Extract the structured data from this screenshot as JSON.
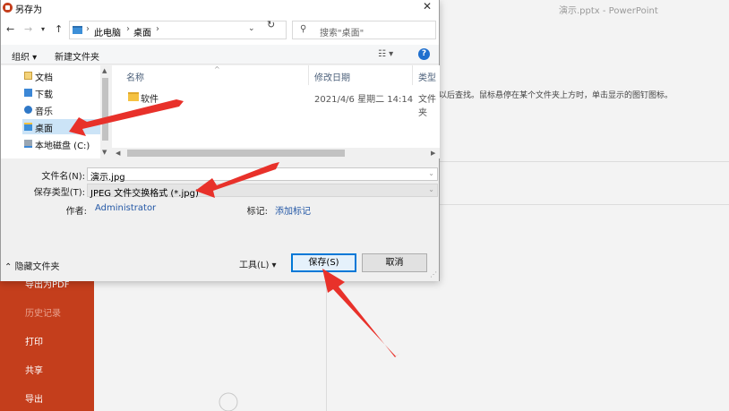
{
  "background": {
    "window_title": "演示.pptx  -  PowerPoint",
    "hint_text": "以后查找。鼠标悬停在某个文件夹上方时，单击显示的图钉图标。",
    "nav": {
      "export_pdf": "导出为PDF",
      "history": "历史记录",
      "print": "打印",
      "share": "共享",
      "export": "导出"
    },
    "accent_color": "#c43e1c"
  },
  "dialog": {
    "title": "另存为",
    "breadcrumb": [
      "此电脑",
      "桌面"
    ],
    "search_placeholder": "搜索\"桌面\"",
    "toolbar": {
      "organize": "组织 ▾",
      "new_folder": "新建文件夹",
      "help": "?"
    },
    "nav_pane": [
      {
        "label": "文档",
        "icon": "documents-icon"
      },
      {
        "label": "下载",
        "icon": "downloads-icon"
      },
      {
        "label": "音乐",
        "icon": "music-icon"
      },
      {
        "label": "桌面",
        "icon": "desktop-icon",
        "selected": true
      },
      {
        "label": "本地磁盘 (C:)",
        "icon": "disk-icon"
      }
    ],
    "columns": {
      "name": "名称",
      "date": "修改日期",
      "type": "类型"
    },
    "files": [
      {
        "name": "软件",
        "date": "2021/4/6 星期二 14:14",
        "type": "文件夹"
      }
    ],
    "form": {
      "filename_label": "文件名(N):",
      "filename_value": "演示.jpg",
      "savetype_label": "保存类型(T):",
      "savetype_value": "JPEG 文件交换格式 (*.jpg)",
      "author_label": "作者:",
      "author_value": "Administrator",
      "tags_label": "标记:",
      "tags_value": "添加标记"
    },
    "footer": {
      "hide_folders": "隐藏文件夹",
      "tools": "工具(L)",
      "save": "保存(S)",
      "cancel": "取消"
    }
  },
  "annotation_color": "#e8312a"
}
